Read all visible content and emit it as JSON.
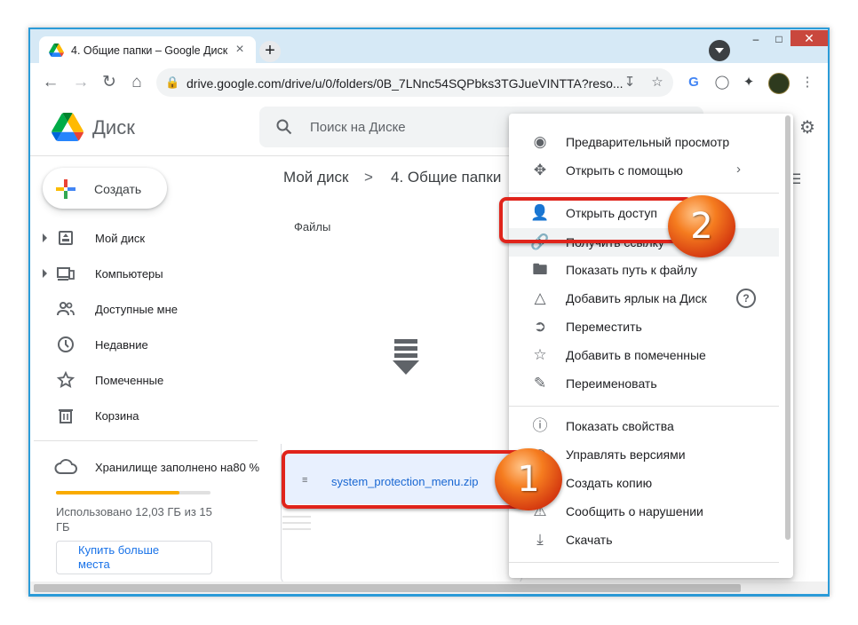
{
  "browser": {
    "tab_title": "4. Общие папки – Google Диск",
    "tab_close": "×",
    "new_tab": "+",
    "url": "drive.google.com/drive/u/0/folders/0B_7LNnc54SQPbks3TGJueVINTTA?reso..."
  },
  "drive": {
    "app_name": "Диск",
    "search_placeholder": "Поиск на Диске",
    "create_label": "Создать"
  },
  "sidebar": {
    "items": [
      {
        "label": "Мой диск",
        "icon": "my-drive-icon",
        "expandable": true
      },
      {
        "label": "Компьютеры",
        "icon": "computers-icon",
        "expandable": true
      },
      {
        "label": "Доступные мне",
        "icon": "shared-with-me-icon",
        "expandable": false
      },
      {
        "label": "Недавние",
        "icon": "recent-icon",
        "expandable": false
      },
      {
        "label": "Помеченные",
        "icon": "star-icon",
        "expandable": false
      },
      {
        "label": "Корзина",
        "icon": "trash-icon",
        "expandable": false
      }
    ],
    "storage_label": "Хранилище заполнено на80 %",
    "storage_percent": 80,
    "storage_used": "Использовано 12,03 ГБ из 15 ГБ",
    "buy_label": "Купить больше места"
  },
  "breadcrumb": {
    "root": "Мой диск",
    "separator": ">",
    "current": "4. Общие папки"
  },
  "main": {
    "files_heading": "Файлы",
    "file_name": "system_protection_menu.zip"
  },
  "context_menu": {
    "items": [
      {
        "label": "Предварительный просмотр",
        "icon": "eye-icon"
      },
      {
        "label": "Открыть с помощью",
        "icon": "open-with-icon",
        "submenu": true
      },
      {
        "label": "Открыть доступ",
        "icon": "share-person-icon"
      },
      {
        "label": "Получить ссылку",
        "icon": "link-icon"
      },
      {
        "label": "Показать путь к файлу",
        "icon": "folder-icon"
      },
      {
        "label": "Добавить ярлык на Диск",
        "icon": "add-shortcut-icon",
        "help": true
      },
      {
        "label": "Переместить",
        "icon": "move-icon"
      },
      {
        "label": "Добавить в помеченные",
        "icon": "star-outline-icon"
      },
      {
        "label": "Переименовать",
        "icon": "pencil-icon"
      },
      {
        "label": "Показать свойства",
        "icon": "info-icon"
      },
      {
        "label": "Управлять версиями",
        "icon": "history-icon"
      },
      {
        "label": "Создать копию",
        "icon": "copy-icon"
      },
      {
        "label": "Сообщить о нарушении",
        "icon": "report-icon"
      },
      {
        "label": "Скачать",
        "icon": "download-icon"
      }
    ]
  },
  "annotations": {
    "step1": "1",
    "step2": "2",
    "highlight_color": "#e0241b"
  }
}
